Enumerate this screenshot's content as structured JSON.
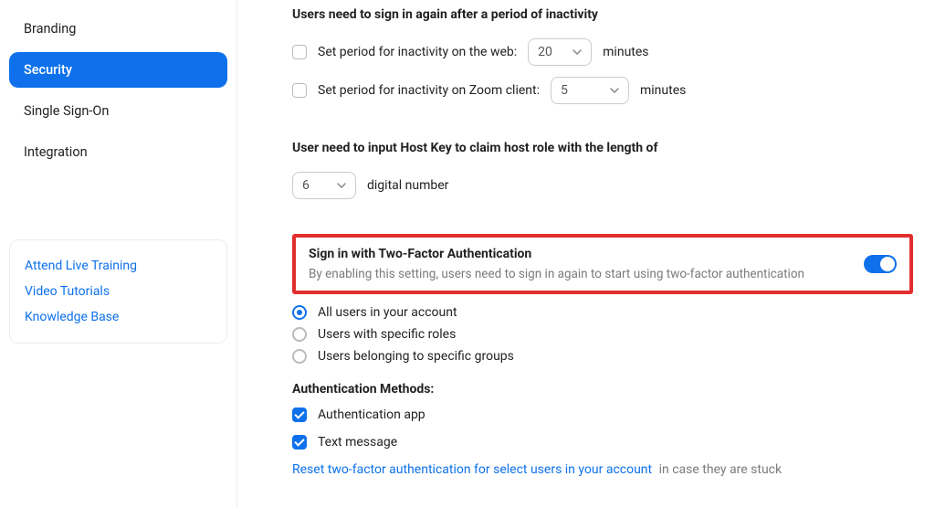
{
  "sidebar": {
    "items": [
      {
        "label": "Branding"
      },
      {
        "label": "Security"
      },
      {
        "label": "Single Sign-On"
      },
      {
        "label": "Integration"
      }
    ],
    "resources": [
      {
        "label": "Attend Live Training"
      },
      {
        "label": "Video Tutorials"
      },
      {
        "label": "Knowledge Base"
      }
    ]
  },
  "inactivity": {
    "heading": "Users need to sign in again after a period of inactivity",
    "web_label": "Set period for inactivity on the web:",
    "web_value": "20",
    "web_unit": "minutes",
    "client_label": "Set period for inactivity on Zoom client:",
    "client_value": "5",
    "client_unit": "minutes"
  },
  "hostkey": {
    "heading": "User need to input Host Key to claim host role with the length of",
    "value": "6",
    "suffix": "digital number"
  },
  "twofa": {
    "title": "Sign in with Two-Factor Authentication",
    "description": "By enabling this setting, users need to sign in again to start using two-factor authentication",
    "options": [
      {
        "label": "All users in your account"
      },
      {
        "label": "Users with specific roles"
      },
      {
        "label": "Users belonging to specific groups"
      }
    ],
    "methods_heading": "Authentication Methods:",
    "methods": [
      {
        "label": "Authentication app"
      },
      {
        "label": "Text message"
      }
    ],
    "reset_link": "Reset two-factor authentication for select users in your account",
    "reset_suffix": "in case they are stuck"
  }
}
